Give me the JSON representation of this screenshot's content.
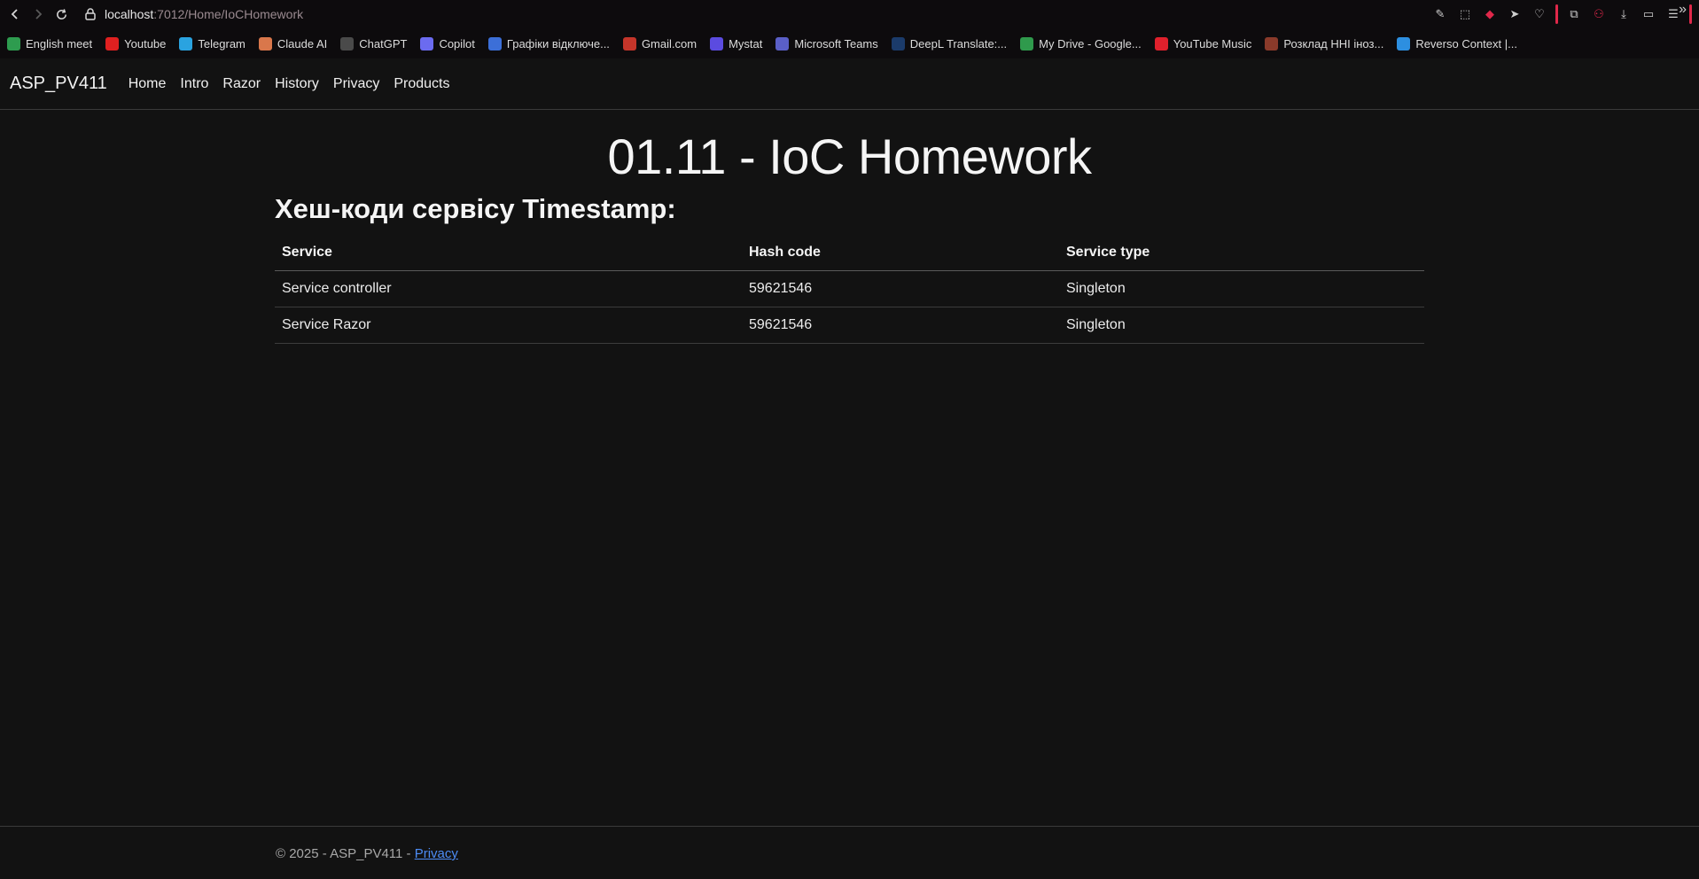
{
  "browser": {
    "url_host": "localhost",
    "url_rest": ":7012/Home/IoCHomework",
    "bookmarks": [
      {
        "label": "English meet",
        "icon": "google-meet-icon",
        "color": "#2e9c4f"
      },
      {
        "label": "Youtube",
        "icon": "youtube-icon",
        "color": "#e02020"
      },
      {
        "label": "Telegram",
        "icon": "telegram-icon",
        "color": "#2aa3e0"
      },
      {
        "label": "Claude AI",
        "icon": "claude-icon",
        "color": "#d9774b"
      },
      {
        "label": "ChatGPT",
        "icon": "chatgpt-icon",
        "color": "#4a4a4a"
      },
      {
        "label": "Copilot",
        "icon": "copilot-icon",
        "color": "#6b6bf0"
      },
      {
        "label": "Графіки відключе...",
        "icon": "power-schedule-icon",
        "color": "#3c6fd8"
      },
      {
        "label": "Gmail.com",
        "icon": "gmail-icon",
        "color": "#c5352a"
      },
      {
        "label": "Mystat",
        "icon": "mystat-icon",
        "color": "#5b4be0"
      },
      {
        "label": "Microsoft Teams",
        "icon": "teams-icon",
        "color": "#5a5fc7"
      },
      {
        "label": "DeepL Translate:...",
        "icon": "deepl-icon",
        "color": "#1b3b6a"
      },
      {
        "label": "My Drive - Google...",
        "icon": "google-drive-icon",
        "color": "#2f9a4c"
      },
      {
        "label": "YouTube Music",
        "icon": "youtube-music-icon",
        "color": "#e0202c"
      },
      {
        "label": "Розклад ННІ іноз...",
        "icon": "schedule-icon",
        "color": "#8a3a2a"
      },
      {
        "label": "Reverso Context |...",
        "icon": "reverso-icon",
        "color": "#2d8fe0"
      }
    ]
  },
  "site": {
    "brand": "ASP_PV411",
    "nav": [
      "Home",
      "Intro",
      "Razor",
      "History",
      "Privacy",
      "Products"
    ]
  },
  "main": {
    "title": "01.11 - IoC Homework",
    "section_title": "Хеш-коди сервісу Timestamp:",
    "table": {
      "headers": [
        "Service",
        "Hash code",
        "Service type"
      ],
      "rows": [
        [
          "Service controller",
          "59621546",
          "Singleton"
        ],
        [
          "Service Razor",
          "59621546",
          "Singleton"
        ]
      ]
    }
  },
  "footer": {
    "text": "© 2025 - ASP_PV411 - ",
    "link": "Privacy"
  }
}
